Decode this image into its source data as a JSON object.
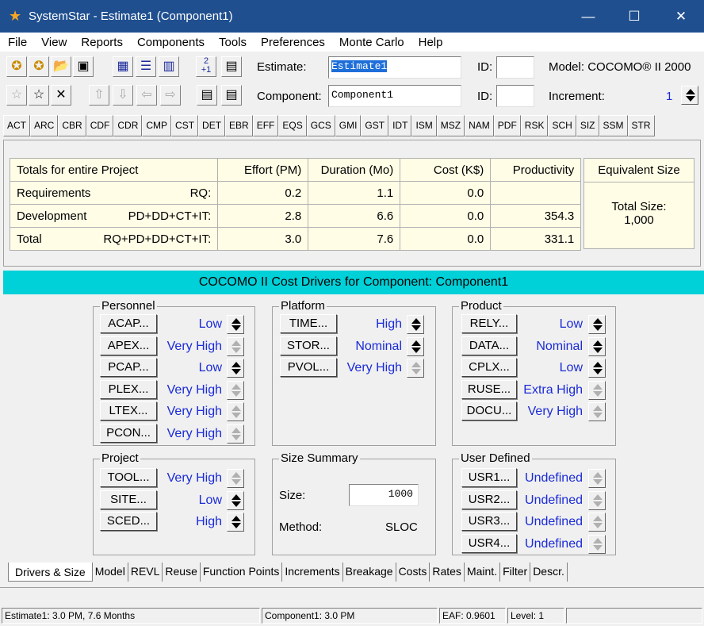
{
  "window": {
    "title": "SystemStar - Estimate1 (Component1)"
  },
  "menu": [
    "File",
    "View",
    "Reports",
    "Components",
    "Tools",
    "Preferences",
    "Monte Carlo",
    "Help"
  ],
  "header": {
    "estimate_label": "Estimate:",
    "estimate_value": "Estimate1",
    "id_label": "ID:",
    "model_label": "Model: COCOMO® II 2000",
    "component_label": "Component:",
    "component_value": "Component1",
    "id2_label": "ID:",
    "increment_label": "Increment:",
    "increment_value": "1",
    "toolbar_num_top": "2",
    "toolbar_num_bottom": "+1"
  },
  "codes": [
    "ACT",
    "ARC",
    "CBR",
    "CDF",
    "CDR",
    "CMP",
    "CST",
    "DET",
    "EBR",
    "EFF",
    "EQS",
    "GCS",
    "GMI",
    "GST",
    "IDT",
    "ISM",
    "MSZ",
    "NAM",
    "PDF",
    "RSK",
    "SCH",
    "SIZ",
    "SSM",
    "STR"
  ],
  "totals": {
    "headers": [
      "Totals for entire Project",
      "Effort (PM)",
      "Duration (Mo)",
      "Cost (K$)",
      "Productivity"
    ],
    "rows": [
      {
        "name": "Requirements",
        "phase": "RQ:",
        "effort": "0.2",
        "duration": "1.1",
        "cost": "0.0",
        "prod": ""
      },
      {
        "name": "Development",
        "phase": "PD+DD+CT+IT:",
        "effort": "2.8",
        "duration": "6.6",
        "cost": "0.0",
        "prod": "354.3"
      },
      {
        "name": "Total",
        "phase": "RQ+PD+DD+CT+IT:",
        "effort": "3.0",
        "duration": "7.6",
        "cost": "0.0",
        "prod": "331.1"
      }
    ],
    "equiv_header": "Equivalent Size",
    "equiv_label": "Total Size:",
    "equiv_value": "1,000"
  },
  "banner": "COCOMO II Cost Drivers for Component: Component1",
  "groups": {
    "personnel": {
      "title": "Personnel",
      "items": [
        {
          "btn": "ACAP...",
          "val": "Low"
        },
        {
          "btn": "APEX...",
          "val": "Very High"
        },
        {
          "btn": "PCAP...",
          "val": "Low"
        },
        {
          "btn": "PLEX...",
          "val": "Very High"
        },
        {
          "btn": "LTEX...",
          "val": "Very High"
        },
        {
          "btn": "PCON...",
          "val": "Very High"
        }
      ]
    },
    "platform": {
      "title": "Platform",
      "items": [
        {
          "btn": "TIME...",
          "val": "High"
        },
        {
          "btn": "STOR...",
          "val": "Nominal"
        },
        {
          "btn": "PVOL...",
          "val": "Very High"
        }
      ]
    },
    "product": {
      "title": "Product",
      "items": [
        {
          "btn": "RELY...",
          "val": "Low"
        },
        {
          "btn": "DATA...",
          "val": "Nominal"
        },
        {
          "btn": "CPLX...",
          "val": "Low"
        },
        {
          "btn": "RUSE...",
          "val": "Extra High"
        },
        {
          "btn": "DOCU...",
          "val": "Very High"
        }
      ]
    },
    "project": {
      "title": "Project",
      "items": [
        {
          "btn": "TOOL...",
          "val": "Very High"
        },
        {
          "btn": "SITE...",
          "val": "Low"
        },
        {
          "btn": "SCED...",
          "val": "High"
        }
      ]
    },
    "size": {
      "title": "Size Summary",
      "size_label": "Size:",
      "size_value": "1000",
      "method_label": "Method:",
      "method_value": "SLOC"
    },
    "user": {
      "title": "User Defined",
      "items": [
        {
          "btn": "USR1...",
          "val": "Undefined"
        },
        {
          "btn": "USR2...",
          "val": "Undefined"
        },
        {
          "btn": "USR3...",
          "val": "Undefined"
        },
        {
          "btn": "USR4...",
          "val": "Undefined"
        }
      ]
    }
  },
  "tabs": [
    "Drivers & Size",
    "Model",
    "REVL",
    "Reuse",
    "Function Points",
    "Increments",
    "Breakage",
    "Costs",
    "Rates",
    "Maint.",
    "Filter",
    "Descr."
  ],
  "status": {
    "left": "Estimate1:  3.0 PM,  7.6 Months",
    "mid": "Component1:  3.0 PM",
    "eaf": "EAF: 0.9601",
    "level": "Level:  1"
  },
  "colors": {
    "title_bar": "#1f4f8f",
    "banner": "#00d0d8",
    "value_text": "#1a2bd8",
    "table_bg": "#fffde6"
  }
}
